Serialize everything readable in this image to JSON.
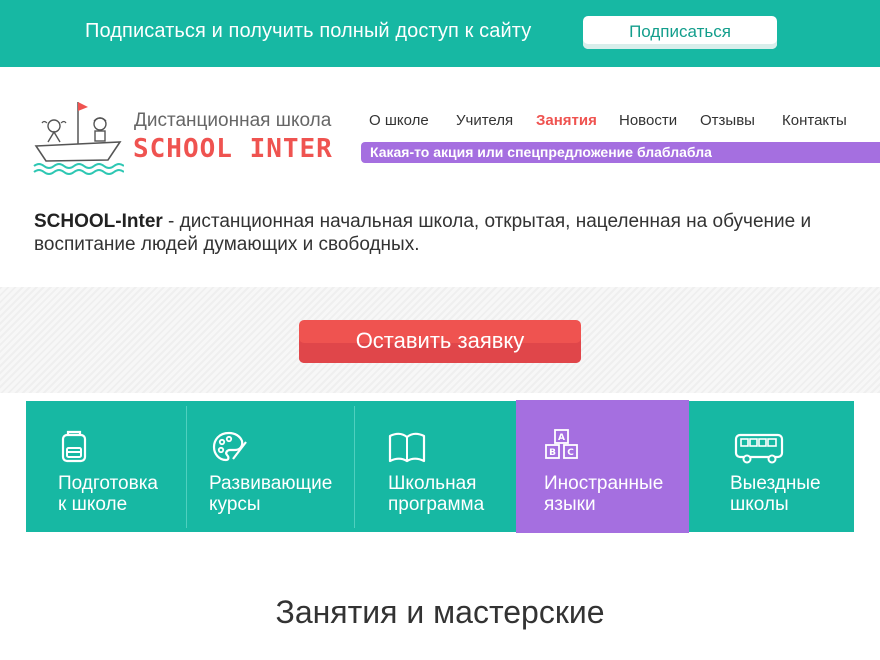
{
  "topbar": {
    "text": "Подписаться и получить полный доступ к сайту",
    "button_label": "Подписаться"
  },
  "logo": {
    "subtitle": "Дистанционная школа",
    "name": "SCHOOL INTER"
  },
  "nav": {
    "items": [
      {
        "label": "О школе",
        "active": false
      },
      {
        "label": "Учителя",
        "active": false
      },
      {
        "label": "Занятия",
        "active": true
      },
      {
        "label": "Новости",
        "active": false
      },
      {
        "label": "Отзывы",
        "active": false
      },
      {
        "label": "Контакты",
        "active": false
      }
    ],
    "promo": "Какая-то акция или спецпредложение блаблабла"
  },
  "intro": {
    "brand": "SCHOOL-Inter",
    "text": " - дистанционная начальная школа, открытая, нацеленная на обучение и воспитание людей думающих и свободных."
  },
  "cta": {
    "label": "Оставить заявку"
  },
  "tiles": [
    {
      "label": "Подготовка\nк школе",
      "icon": "backpack-icon"
    },
    {
      "label": "Развивающие\nкурсы",
      "icon": "palette-icon"
    },
    {
      "label": "Школьная\nпрограмма",
      "icon": "book-icon"
    },
    {
      "label": "Иностранные\nязыки",
      "icon": "abc-blocks-icon"
    },
    {
      "label": "Выездные\nшколы",
      "icon": "bus-icon"
    }
  ],
  "section": {
    "title": "Занятия и мастерские"
  },
  "colors": {
    "teal": "#17b8a3",
    "red": "#ef5350",
    "purple": "#a56fe0"
  }
}
